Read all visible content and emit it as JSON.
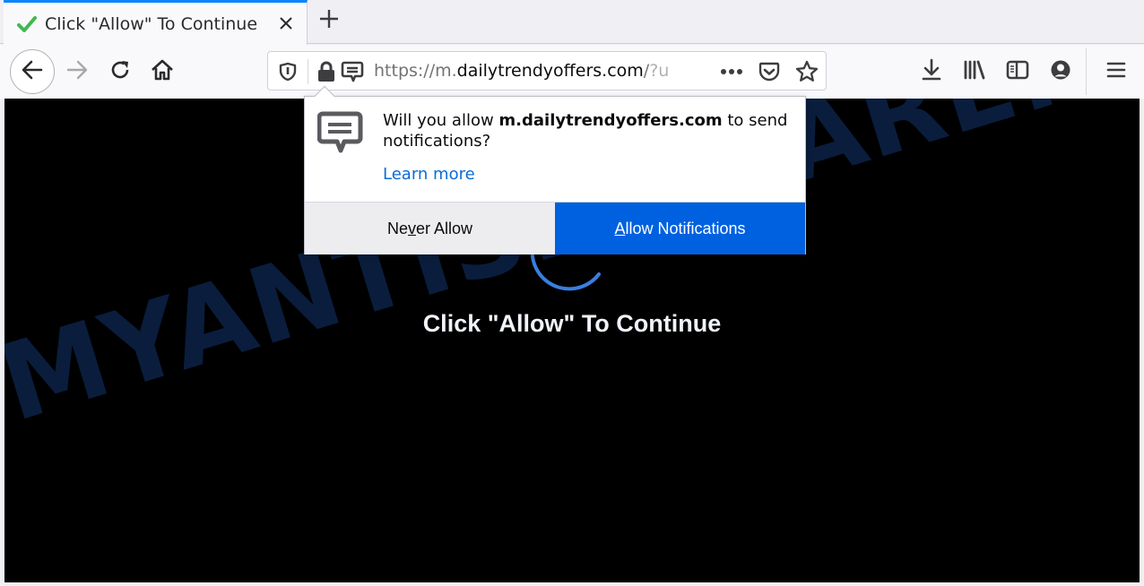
{
  "browser": {
    "tab": {
      "title": "Click \"Allow\" To Continue",
      "favicon": "green-checkmark-icon",
      "close_icon": "close-icon"
    },
    "new_tab_icon": "plus-icon",
    "nav": {
      "back_icon": "arrow-left-icon",
      "forward_icon": "arrow-right-icon",
      "reload_icon": "reload-icon",
      "home_icon": "home-icon"
    },
    "urlbar": {
      "tracking_icon": "shield-icon",
      "lock_icon": "lock-icon",
      "permission_icon": "speech-bubble-icon",
      "url_scheme": "https://m.",
      "url_host": "dailytrendyoffers.com",
      "url_path": "/",
      "url_query_fade": "?ut",
      "page_actions_icon": "ellipsis-icon",
      "pocket_icon": "pocket-icon",
      "bookmark_icon": "star-icon"
    },
    "toolbar": {
      "downloads_icon": "download-icon",
      "library_icon": "library-icon",
      "sidebar_icon": "sidebar-icon",
      "account_icon": "account-icon",
      "menu_icon": "hamburger-menu-icon"
    }
  },
  "popup": {
    "message_prefix": "Will you allow ",
    "message_host": "m.dailytrendyoffers.com",
    "message_suffix": " to send notifications?",
    "learn_more": "Learn more",
    "never_allow": {
      "before": "Ne",
      "accesskey": "v",
      "after": "er Allow"
    },
    "allow": {
      "before": "",
      "accesskey": "A",
      "after": "llow Notifications"
    }
  },
  "page": {
    "message": "Click \"Allow\" To Continue",
    "watermark": "MYANTISPYWARE.COM"
  },
  "colors": {
    "accent_blue": "#0061e0",
    "tab_highlight": "#0a84ff",
    "link_blue": "#0a6cd6",
    "spinner_blue": "#3a7ee0",
    "watermark_navy": "#0a1d3d",
    "favicon_green": "#3fb950"
  }
}
